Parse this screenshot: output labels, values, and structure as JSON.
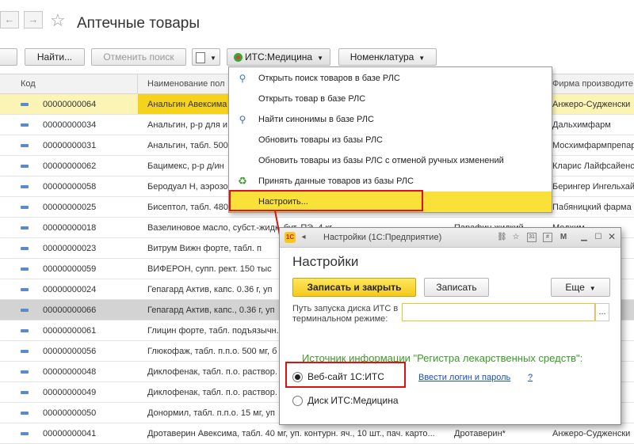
{
  "window": {
    "title": "Аптечные товары"
  },
  "nav": {
    "back": "←",
    "forward": "→"
  },
  "toolbar": {
    "find_label": "Найти...",
    "cancel_search_label": "Отменить поиск",
    "its_label": "ИТС:Медицина",
    "nomenclature_label": "Номенклатура"
  },
  "table": {
    "columns": [
      "Код",
      "Наименование пол",
      "Фирма производите"
    ],
    "rows": [
      {
        "code": "00000000064",
        "name": "Анальгин Авексима",
        "firm": "Анжеро-Судженски"
      },
      {
        "code": "00000000034",
        "name": "Анальгин, р-р для и",
        "firm": "Дальхимфарм"
      },
      {
        "code": "00000000031",
        "name": "Анальгин, табл. 500",
        "firm": "Мосхимфармпрепар"
      },
      {
        "code": "00000000062",
        "name": "Бацимекс, р-р д/ин",
        "firm": "Кларис Лайфсайенс"
      },
      {
        "code": "00000000058",
        "name": "Беродуал Н, аэрозо",
        "firm": "Берингер Ингельхай"
      },
      {
        "code": "00000000025",
        "name": "Бисептол, табл. 480",
        "firm": "Пабяницкий фарма"
      },
      {
        "code": "00000000018",
        "name": "Вазелиновое масло, субст.-жидк. бут. ПЭ, 4 кг",
        "firm": "Медхим"
      },
      {
        "code": "00000000023",
        "name": "Витрум Вижн форте, табл. п",
        "firm": ""
      },
      {
        "code": "00000000059",
        "name": "ВИФЕРОН, супп. рект. 150 тыс",
        "firm": ""
      },
      {
        "code": "00000000024",
        "name": "Гепагард Актив, капс. 0.36 г, уп",
        "firm": ""
      },
      {
        "code": "00000000066",
        "name": "Гепагард Актив, капс., 0.36 г, уп",
        "firm": ""
      },
      {
        "code": "00000000061",
        "name": "Глицин форте, табл. подъязычн.",
        "firm": ""
      },
      {
        "code": "00000000056",
        "name": "Глюкофаж, табл. п.п.о. 500 мг, б",
        "firm": ""
      },
      {
        "code": "00000000048",
        "name": "Диклофенак, табл. п.о. раствор.",
        "firm": ""
      },
      {
        "code": "00000000049",
        "name": "Диклофенак, табл. п.о. раствор.",
        "firm": ""
      },
      {
        "code": "00000000050",
        "name": "Донормил, табл. п.п.о. 15 мг, уп",
        "firm": ""
      },
      {
        "code": "00000000041",
        "name": "Дротаверин Авексима, табл. 40 мг, уп. контурн. яч., 10 шт., пач. карто...",
        "firm": "Анжеро-Судженски"
      }
    ],
    "extra_cells": {
      "row6_subst": "Парафин жидкий",
      "row16_subst": "Дротаверин*"
    }
  },
  "menu": {
    "items": [
      {
        "label": "Открыть поиск товаров в базе РЛС",
        "icon": "🔍"
      },
      {
        "label": "Открыть товар в базе РЛС",
        "icon": ""
      },
      {
        "label": "Найти синонимы в базе РЛС",
        "icon": "🔍"
      },
      {
        "label": "Обновить товары из базы РЛС",
        "icon": ""
      },
      {
        "label": "Обновить товары из базы РЛС с отменой ручных изменений",
        "icon": ""
      },
      {
        "label": "Принять данные товаров из базы РЛС",
        "icon": "♻"
      },
      {
        "label": "Настроить...",
        "icon": ""
      }
    ]
  },
  "dialog": {
    "window_title": "Настройки (1С:Предприятие)",
    "heading": "Настройки",
    "save_close": "Записать и закрыть",
    "save": "Записать",
    "more": "Еще",
    "its_path_label": "Путь запуска диска ИТС в терминальном режиме:",
    "its_path_value": "",
    "browse": "...",
    "source_heading": "Источник информации \"Регистра лекарственных средств\":",
    "option_web": "Веб-сайт 1С:ИТС",
    "option_disk": "Диск ИТС:Медицина",
    "login_link": "Ввести логин и пароль",
    "help": "?"
  },
  "colors": {
    "accent": "#f5c91a",
    "highlight": "#f9e13a",
    "annotation": "#dd1111",
    "link": "#1a4fb5",
    "heading_green": "#3a9a2a"
  }
}
